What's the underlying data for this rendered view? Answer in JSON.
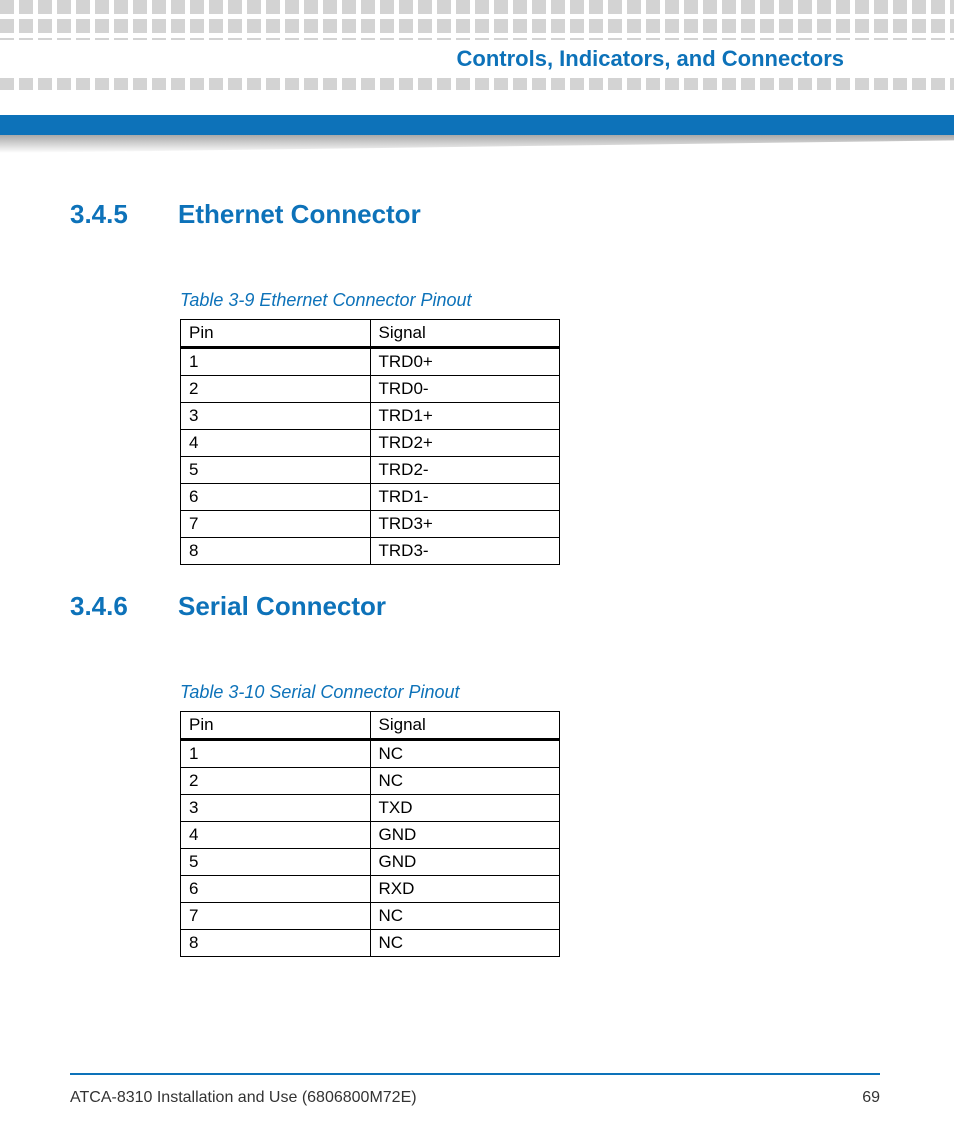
{
  "header": {
    "chapter_title": "Controls, Indicators, and Connectors"
  },
  "sections": [
    {
      "number": "3.4.5",
      "title": "Ethernet Connector",
      "table": {
        "caption": "Table 3-9 Ethernet Connector Pinout",
        "col1": "Pin",
        "col2": "Signal",
        "rows": [
          {
            "pin": "1",
            "signal": "TRD0+"
          },
          {
            "pin": "2",
            "signal": "TRD0-"
          },
          {
            "pin": "3",
            "signal": "TRD1+"
          },
          {
            "pin": "4",
            "signal": "TRD2+"
          },
          {
            "pin": "5",
            "signal": "TRD2-"
          },
          {
            "pin": "6",
            "signal": "TRD1-"
          },
          {
            "pin": "7",
            "signal": "TRD3+"
          },
          {
            "pin": "8",
            "signal": "TRD3-"
          }
        ]
      }
    },
    {
      "number": "3.4.6",
      "title": "Serial Connector",
      "table": {
        "caption": "Table 3-10 Serial Connector Pinout",
        "col1": "Pin",
        "col2": "Signal",
        "rows": [
          {
            "pin": "1",
            "signal": "NC"
          },
          {
            "pin": "2",
            "signal": "NC"
          },
          {
            "pin": "3",
            "signal": "TXD"
          },
          {
            "pin": "4",
            "signal": "GND"
          },
          {
            "pin": "5",
            "signal": "GND"
          },
          {
            "pin": "6",
            "signal": "RXD"
          },
          {
            "pin": "7",
            "signal": "NC"
          },
          {
            "pin": "8",
            "signal": "NC"
          }
        ]
      }
    }
  ],
  "footer": {
    "doc_title": "ATCA-8310 Installation and Use (6806800M72E)",
    "page_number": "69"
  }
}
